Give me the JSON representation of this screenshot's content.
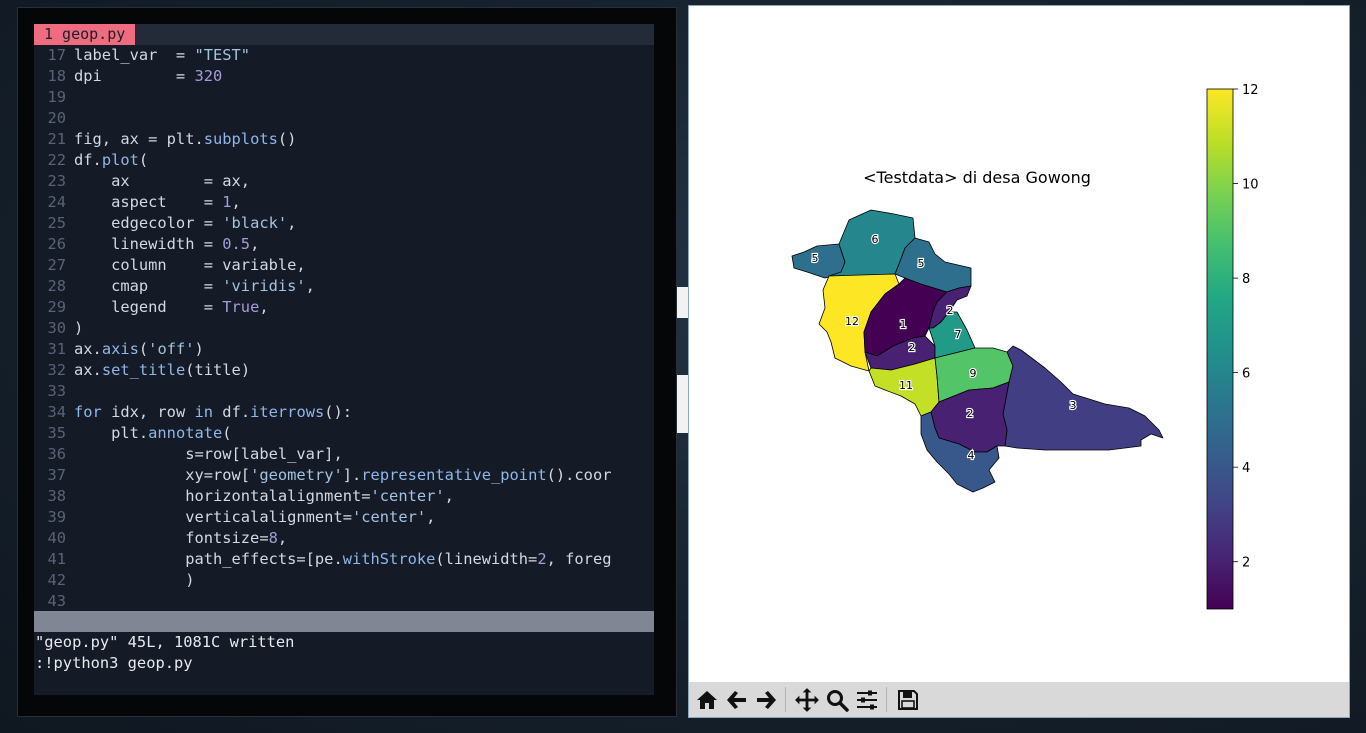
{
  "editor": {
    "tab_label": "1 geop.py",
    "lines": [
      {
        "n": "17",
        "code": [
          [
            "t",
            "label_var  = "
          ],
          [
            "s",
            "\"TEST\""
          ]
        ]
      },
      {
        "n": "18",
        "code": [
          [
            "t",
            "dpi        = "
          ],
          [
            "n",
            "320"
          ]
        ]
      },
      {
        "n": "19",
        "code": []
      },
      {
        "n": "20",
        "code": []
      },
      {
        "n": "21",
        "code": [
          [
            "t",
            "fig, ax = plt."
          ],
          [
            "f",
            "subplots"
          ],
          [
            "t",
            "()"
          ]
        ]
      },
      {
        "n": "22",
        "code": [
          [
            "t",
            "df."
          ],
          [
            "f",
            "plot"
          ],
          [
            "t",
            "("
          ]
        ]
      },
      {
        "n": "23",
        "code": [
          [
            "t",
            "    ax        = ax,"
          ]
        ]
      },
      {
        "n": "24",
        "code": [
          [
            "t",
            "    aspect    = "
          ],
          [
            "n",
            "1"
          ],
          [
            "t",
            ","
          ]
        ]
      },
      {
        "n": "25",
        "code": [
          [
            "t",
            "    edgecolor = "
          ],
          [
            "s",
            "'black'"
          ],
          [
            "t",
            ","
          ]
        ]
      },
      {
        "n": "26",
        "code": [
          [
            "t",
            "    linewidth = "
          ],
          [
            "n",
            "0.5"
          ],
          [
            "t",
            ","
          ]
        ]
      },
      {
        "n": "27",
        "code": [
          [
            "t",
            "    column    = variable,"
          ]
        ]
      },
      {
        "n": "28",
        "code": [
          [
            "t",
            "    cmap      = "
          ],
          [
            "s",
            "'viridis'"
          ],
          [
            "t",
            ","
          ]
        ]
      },
      {
        "n": "29",
        "code": [
          [
            "t",
            "    legend    = "
          ],
          [
            "n",
            "True"
          ],
          [
            "t",
            ","
          ]
        ]
      },
      {
        "n": "30",
        "code": [
          [
            "t",
            ")"
          ]
        ]
      },
      {
        "n": "31",
        "code": [
          [
            "t",
            "ax."
          ],
          [
            "f",
            "axis"
          ],
          [
            "t",
            "("
          ],
          [
            "s",
            "'off'"
          ],
          [
            "t",
            ")"
          ]
        ]
      },
      {
        "n": "32",
        "code": [
          [
            "t",
            "ax."
          ],
          [
            "f",
            "set_title"
          ],
          [
            "t",
            "(title)"
          ]
        ]
      },
      {
        "n": "33",
        "code": []
      },
      {
        "n": "34",
        "code": [
          [
            "k",
            "for"
          ],
          [
            "t",
            " idx, row "
          ],
          [
            "k",
            "in"
          ],
          [
            "t",
            " df."
          ],
          [
            "f",
            "iterrows"
          ],
          [
            "t",
            "():"
          ]
        ]
      },
      {
        "n": "35",
        "code": [
          [
            "t",
            "    plt."
          ],
          [
            "f",
            "annotate"
          ],
          [
            "t",
            "("
          ]
        ]
      },
      {
        "n": "36",
        "code": [
          [
            "t",
            "            s=row[label_var],"
          ]
        ]
      },
      {
        "n": "37",
        "code": [
          [
            "t",
            "            xy=row["
          ],
          [
            "s",
            "'geometry'"
          ],
          [
            "t",
            "]."
          ],
          [
            "f",
            "representative_point"
          ],
          [
            "t",
            "().coor"
          ]
        ]
      },
      {
        "n": "38",
        "code": [
          [
            "t",
            "            horizontalalignment="
          ],
          [
            "s",
            "'center'"
          ],
          [
            "t",
            ","
          ]
        ]
      },
      {
        "n": "39",
        "code": [
          [
            "t",
            "            verticalalignment="
          ],
          [
            "s",
            "'center'"
          ],
          [
            "t",
            ","
          ]
        ]
      },
      {
        "n": "40",
        "code": [
          [
            "t",
            "            fontsize="
          ],
          [
            "n",
            "8"
          ],
          [
            "t",
            ","
          ]
        ]
      },
      {
        "n": "41",
        "code": [
          [
            "t",
            "            path_effects=[pe."
          ],
          [
            "f",
            "withStroke"
          ],
          [
            "t",
            "(linewidth="
          ],
          [
            "n",
            "2"
          ],
          [
            "t",
            ", foreg"
          ]
        ]
      },
      {
        "n": "42",
        "code": [
          [
            "t",
            "            )"
          ]
        ]
      },
      {
        "n": "43",
        "code": []
      }
    ],
    "message_line": "\"geop.py\" 45L, 1081C written",
    "command_line": ":!python3 geop.py"
  },
  "figure": {
    "title": "<Testdata> di desa Gowong",
    "colorbar": {
      "ticks": [
        "2",
        "4",
        "6",
        "8",
        "10",
        "12"
      ]
    },
    "toolbar": [
      {
        "name": "home-icon",
        "label": "Home"
      },
      {
        "name": "back-icon",
        "label": "Back"
      },
      {
        "name": "forward-icon",
        "label": "Forward"
      },
      {
        "name": "pan-icon",
        "label": "Pan"
      },
      {
        "name": "zoom-icon",
        "label": "Zoom"
      },
      {
        "name": "configure-subplots-icon",
        "label": "Subplots"
      },
      {
        "name": "save-icon",
        "label": "Save"
      }
    ]
  },
  "chart_data": {
    "type": "choropleth",
    "title": "<Testdata> di desa Gowong",
    "colormap": "viridis",
    "vmin": 1,
    "vmax": 12,
    "colorbar_ticks": [
      2,
      4,
      6,
      8,
      10,
      12
    ],
    "regions": [
      {
        "label": "5",
        "value": 5
      },
      {
        "label": "6",
        "value": 6
      },
      {
        "label": "5",
        "value": 5
      },
      {
        "label": "12",
        "value": 12
      },
      {
        "label": "1",
        "value": 1
      },
      {
        "label": "2",
        "value": 2
      },
      {
        "label": "2",
        "value": 2
      },
      {
        "label": "7",
        "value": 7
      },
      {
        "label": "11",
        "value": 11
      },
      {
        "label": "9",
        "value": 9
      },
      {
        "label": "3",
        "value": 3
      },
      {
        "label": "2",
        "value": 2
      },
      {
        "label": "4",
        "value": 4
      }
    ]
  }
}
